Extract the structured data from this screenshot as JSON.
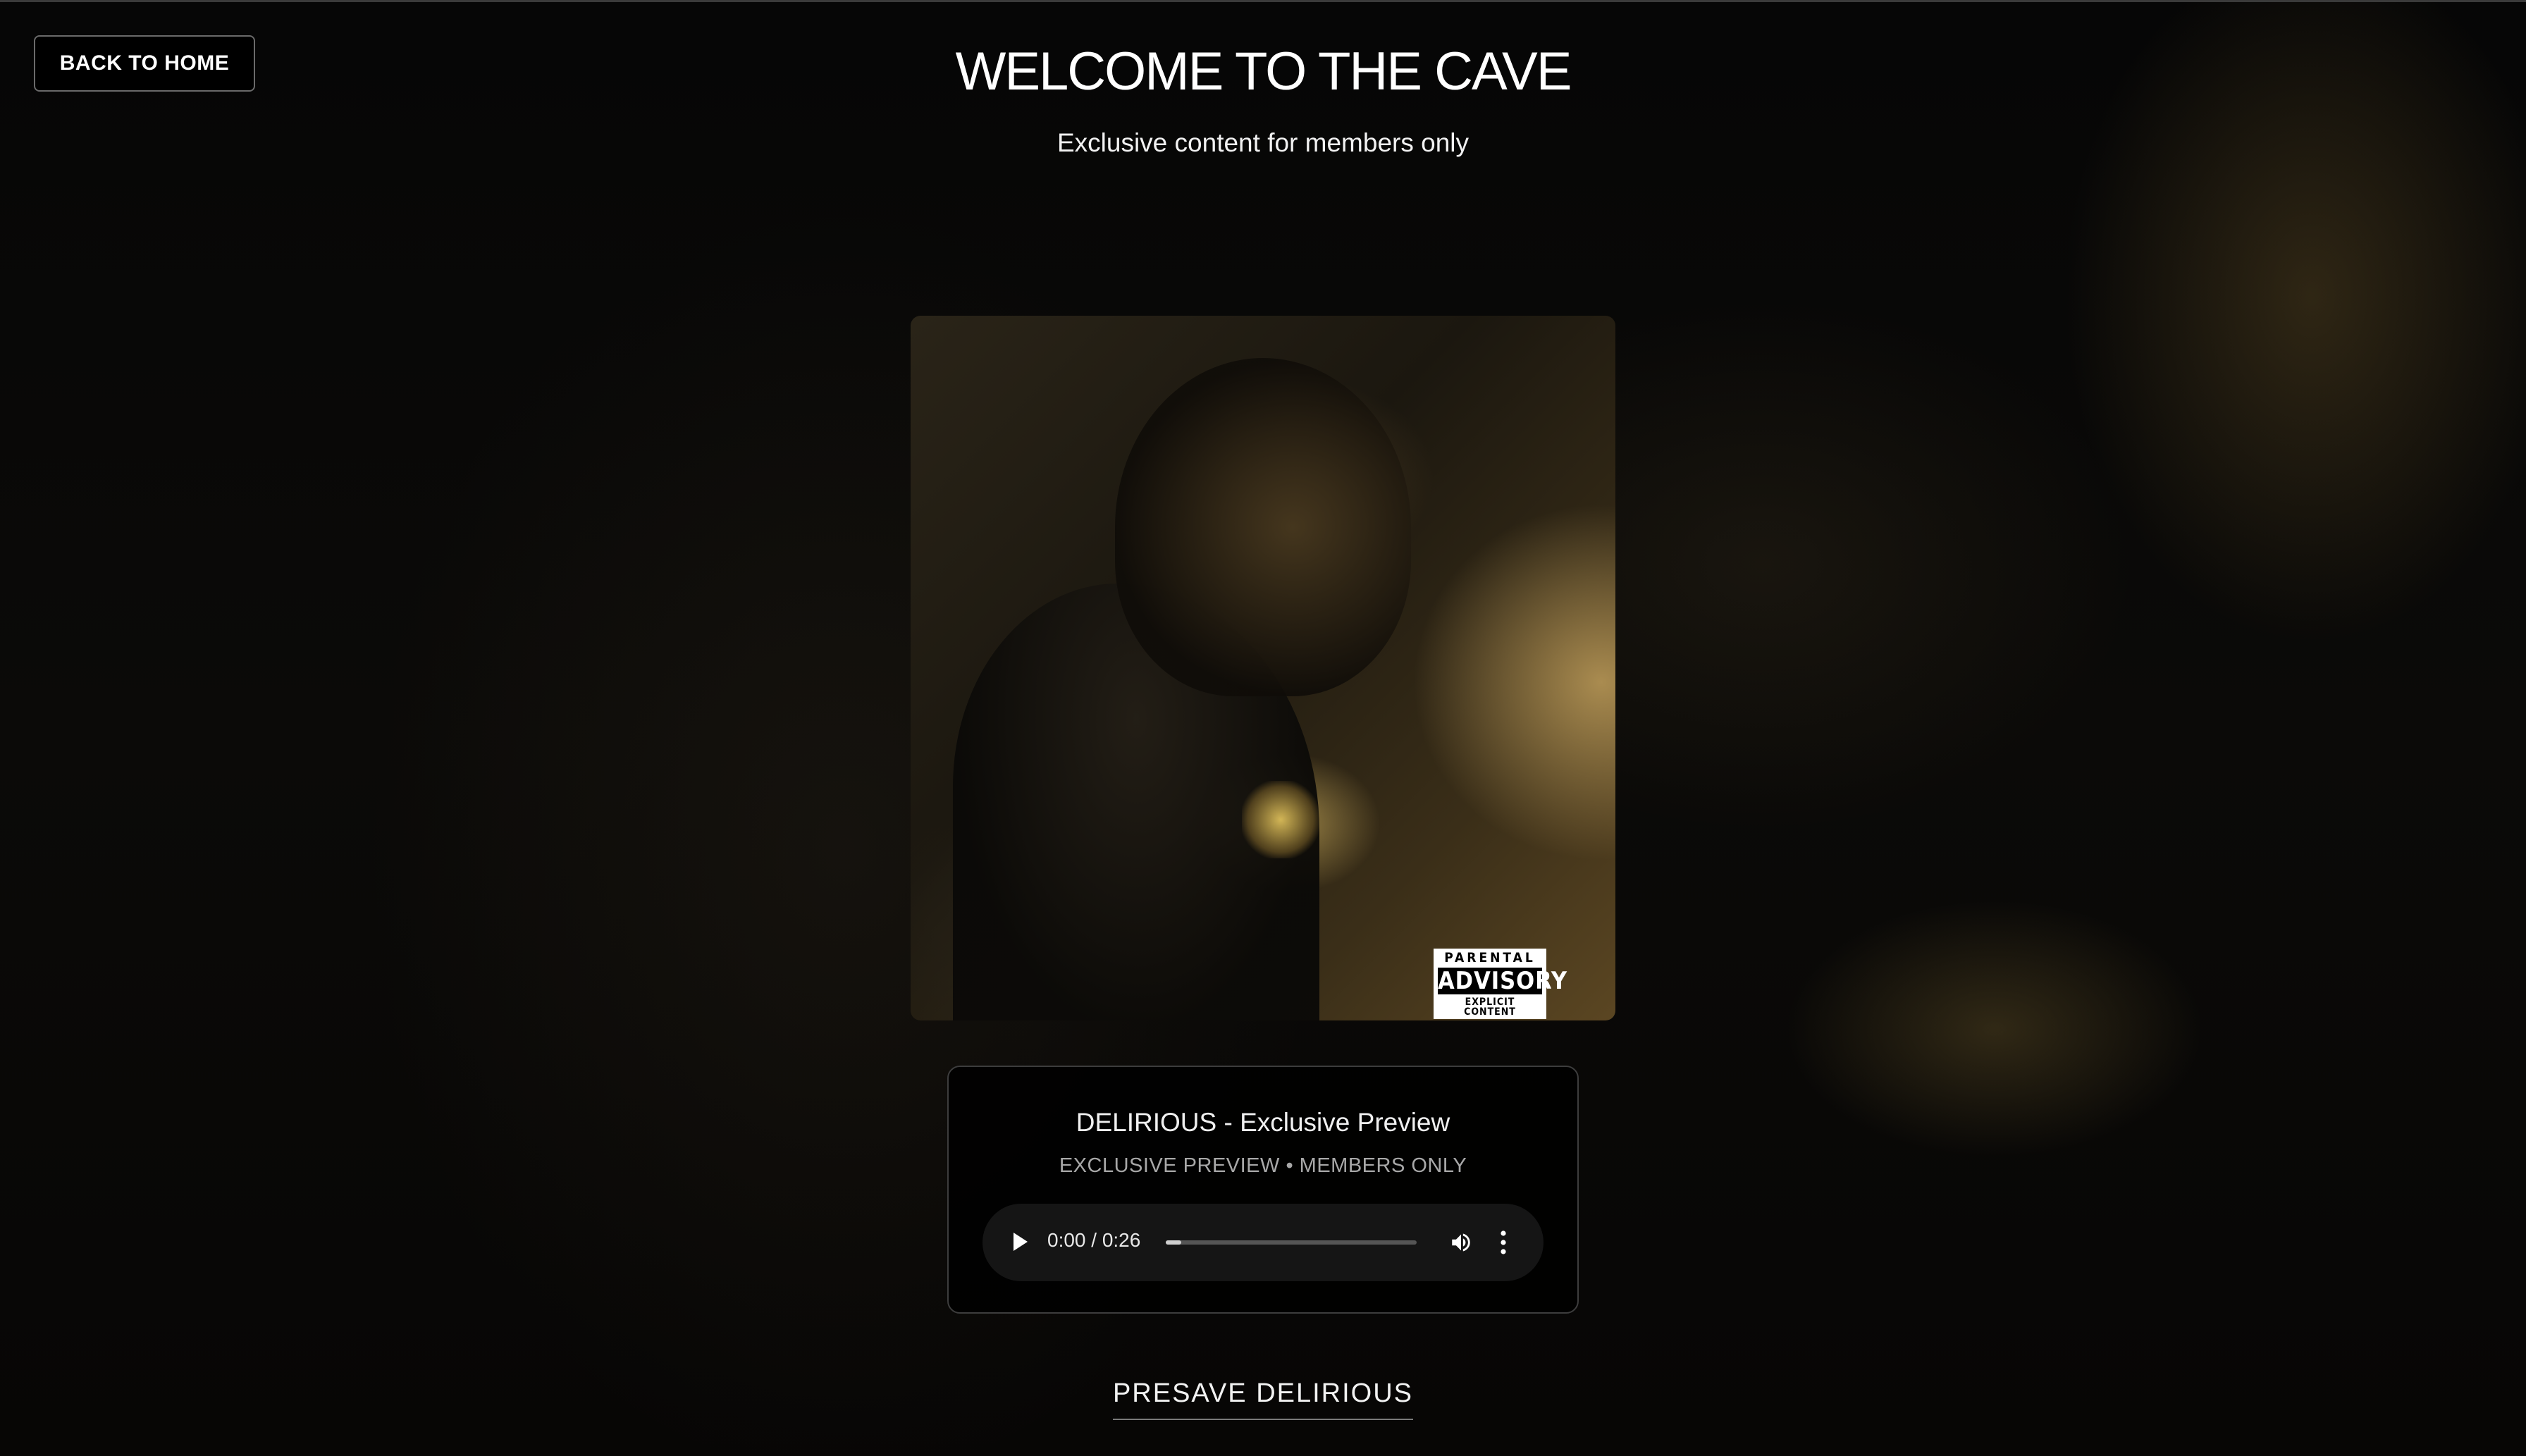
{
  "nav": {
    "back_label": "BACK TO HOME"
  },
  "header": {
    "title": "WELCOME TO THE CAVE",
    "subtitle": "Exclusive content for members only"
  },
  "album": {
    "advisory": {
      "top": "PARENTAL",
      "middle": "ADVISORY",
      "bottom": "EXPLICIT CONTENT"
    }
  },
  "player": {
    "track_title": "DELIRIOUS - Exclusive Preview",
    "meta": "EXCLUSIVE PREVIEW • MEMBERS ONLY",
    "time": "0:00 / 0:26",
    "progress": 0.0
  },
  "cta": {
    "presave_label": "PRESAVE DELIRIOUS"
  },
  "colors": {
    "background": "#050505",
    "text": "#ffffff",
    "muted": "#a8a8a8",
    "card_border": "#3d3d3d"
  }
}
